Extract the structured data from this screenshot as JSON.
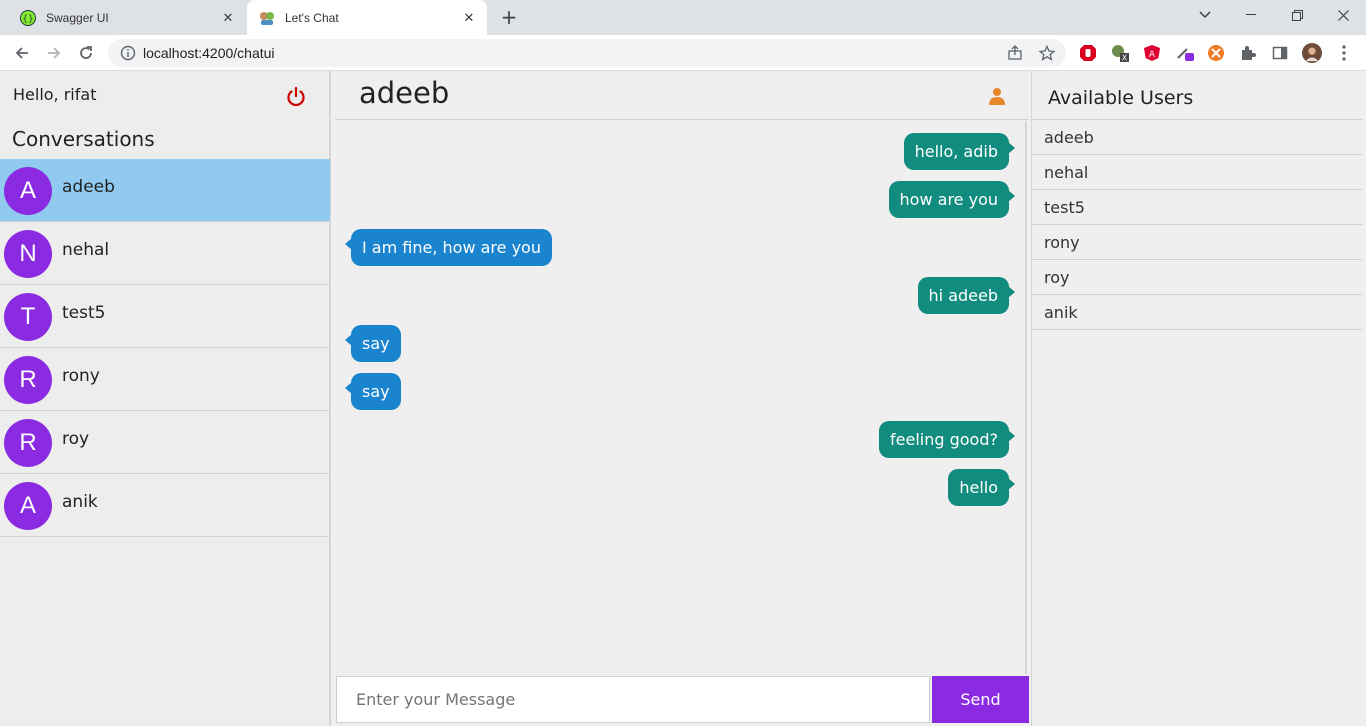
{
  "browser": {
    "tabs": [
      {
        "title": "Swagger UI",
        "icon": "swagger-icon"
      },
      {
        "title": "Let's Chat",
        "icon": "chat-favicon"
      }
    ],
    "url": "localhost:4200/chatui"
  },
  "sidebar": {
    "greeting": "Hello, rifat",
    "title": "Conversations",
    "items": [
      {
        "initial": "A",
        "name": "adeeb",
        "active": true
      },
      {
        "initial": "N",
        "name": "nehal"
      },
      {
        "initial": "T",
        "name": "test5"
      },
      {
        "initial": "R",
        "name": "rony"
      },
      {
        "initial": "R",
        "name": "roy"
      },
      {
        "initial": "A",
        "name": "anik"
      }
    ]
  },
  "chat": {
    "recipient": "adeeb",
    "messages": [
      {
        "text": "hello, adib",
        "direction": "sent"
      },
      {
        "text": "how are you",
        "direction": "sent"
      },
      {
        "text": "I am fine, how are you",
        "direction": "received"
      },
      {
        "text": "hi adeeb",
        "direction": "sent"
      },
      {
        "text": "say",
        "direction": "received"
      },
      {
        "text": "say",
        "direction": "received"
      },
      {
        "text": "feeling good?",
        "direction": "sent"
      },
      {
        "text": "hello",
        "direction": "sent"
      }
    ],
    "input_placeholder": "Enter your Message",
    "send_label": "Send"
  },
  "available": {
    "title": "Available Users",
    "users": [
      "adeeb",
      "nehal",
      "test5",
      "rony",
      "roy",
      "anik"
    ]
  },
  "colors": {
    "accent": "#8a2be2",
    "sent_bubble": "#128c7e",
    "received_bubble": "#1a84cf",
    "active_conversation": "#90caf0",
    "power_icon": "#cc0000"
  }
}
